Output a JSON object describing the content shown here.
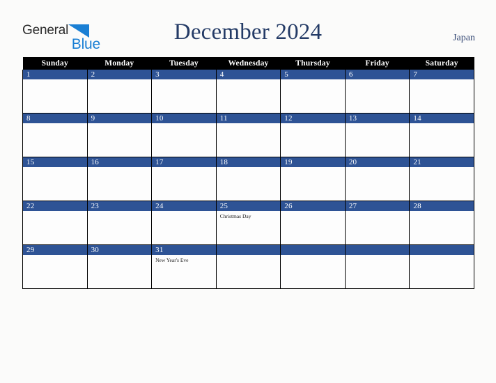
{
  "brand": {
    "name_part1": "General",
    "name_part2": "Blue",
    "triangle_icon": "blue-triangle-icon",
    "colors": {
      "text_dark": "#2b2b2b",
      "accent_blue": "#1a7fd4"
    }
  },
  "header": {
    "title": "December 2024",
    "country": "Japan",
    "title_color": "#243b66"
  },
  "calendar": {
    "month": "December",
    "year": "2024",
    "weekday_headers": [
      "Sunday",
      "Monday",
      "Tuesday",
      "Wednesday",
      "Thursday",
      "Friday",
      "Saturday"
    ],
    "colors": {
      "header_bg": "#000000",
      "header_text": "#ffffff",
      "daynum_bg": "#2e5395",
      "daynum_text": "#ffffff",
      "cell_bg": "#fdfdfd",
      "grid_line": "#000000",
      "page_bg": "#fbfbfa"
    },
    "weeks": [
      [
        {
          "day": "1",
          "events": []
        },
        {
          "day": "2",
          "events": []
        },
        {
          "day": "3",
          "events": []
        },
        {
          "day": "4",
          "events": []
        },
        {
          "day": "5",
          "events": []
        },
        {
          "day": "6",
          "events": []
        },
        {
          "day": "7",
          "events": []
        }
      ],
      [
        {
          "day": "8",
          "events": []
        },
        {
          "day": "9",
          "events": []
        },
        {
          "day": "10",
          "events": []
        },
        {
          "day": "11",
          "events": []
        },
        {
          "day": "12",
          "events": []
        },
        {
          "day": "13",
          "events": []
        },
        {
          "day": "14",
          "events": []
        }
      ],
      [
        {
          "day": "15",
          "events": []
        },
        {
          "day": "16",
          "events": []
        },
        {
          "day": "17",
          "events": []
        },
        {
          "day": "18",
          "events": []
        },
        {
          "day": "19",
          "events": []
        },
        {
          "day": "20",
          "events": []
        },
        {
          "day": "21",
          "events": []
        }
      ],
      [
        {
          "day": "22",
          "events": []
        },
        {
          "day": "23",
          "events": []
        },
        {
          "day": "24",
          "events": []
        },
        {
          "day": "25",
          "events": [
            "Christmas Day"
          ]
        },
        {
          "day": "26",
          "events": []
        },
        {
          "day": "27",
          "events": []
        },
        {
          "day": "28",
          "events": []
        }
      ],
      [
        {
          "day": "29",
          "events": []
        },
        {
          "day": "30",
          "events": []
        },
        {
          "day": "31",
          "events": [
            "New Year's Eve"
          ]
        },
        {
          "day": "",
          "events": []
        },
        {
          "day": "",
          "events": []
        },
        {
          "day": "",
          "events": []
        },
        {
          "day": "",
          "events": []
        }
      ]
    ]
  }
}
